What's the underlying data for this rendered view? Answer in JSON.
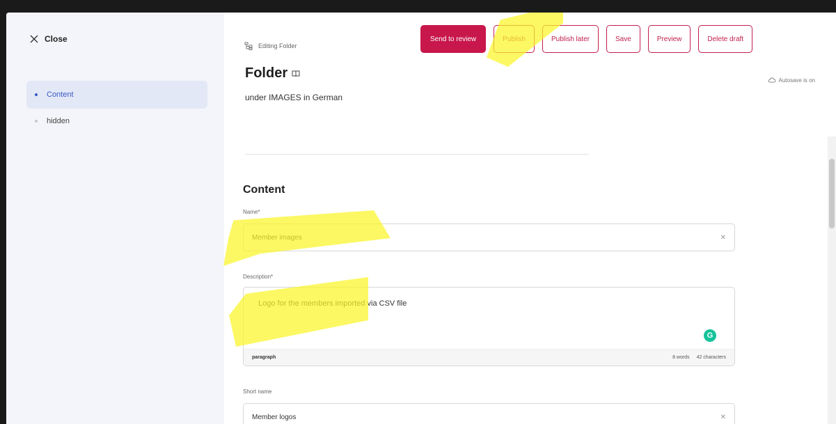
{
  "sidebar": {
    "close_label": "Close",
    "items": [
      {
        "label": "Content",
        "active": true
      },
      {
        "label": "hidden",
        "active": false
      }
    ]
  },
  "header": {
    "editing_label": "Editing Folder",
    "title": "Folder",
    "subtitle": "under IMAGES in German",
    "autosave": "Autosave is on"
  },
  "toolbar": {
    "send_to_review": "Send to review",
    "publish": "Publish",
    "publish_later": "Publish later",
    "save": "Save",
    "preview": "Preview",
    "delete_draft": "Delete draft"
  },
  "content": {
    "heading": "Content",
    "name_label": "Name*",
    "name_value": "Member images",
    "description_label": "Description*",
    "description_value": "Logo for the members imported via CSV file",
    "description_format": "paragraph",
    "word_count": "8 words",
    "char_count": "42 characters",
    "short_name_label": "Short name",
    "short_name_value": "Member logos"
  },
  "colors": {
    "primary": "#c8174b",
    "accent_blue": "#3a59c7",
    "sidebar_bg": "#f4f5fa",
    "highlight": "#faf528"
  }
}
